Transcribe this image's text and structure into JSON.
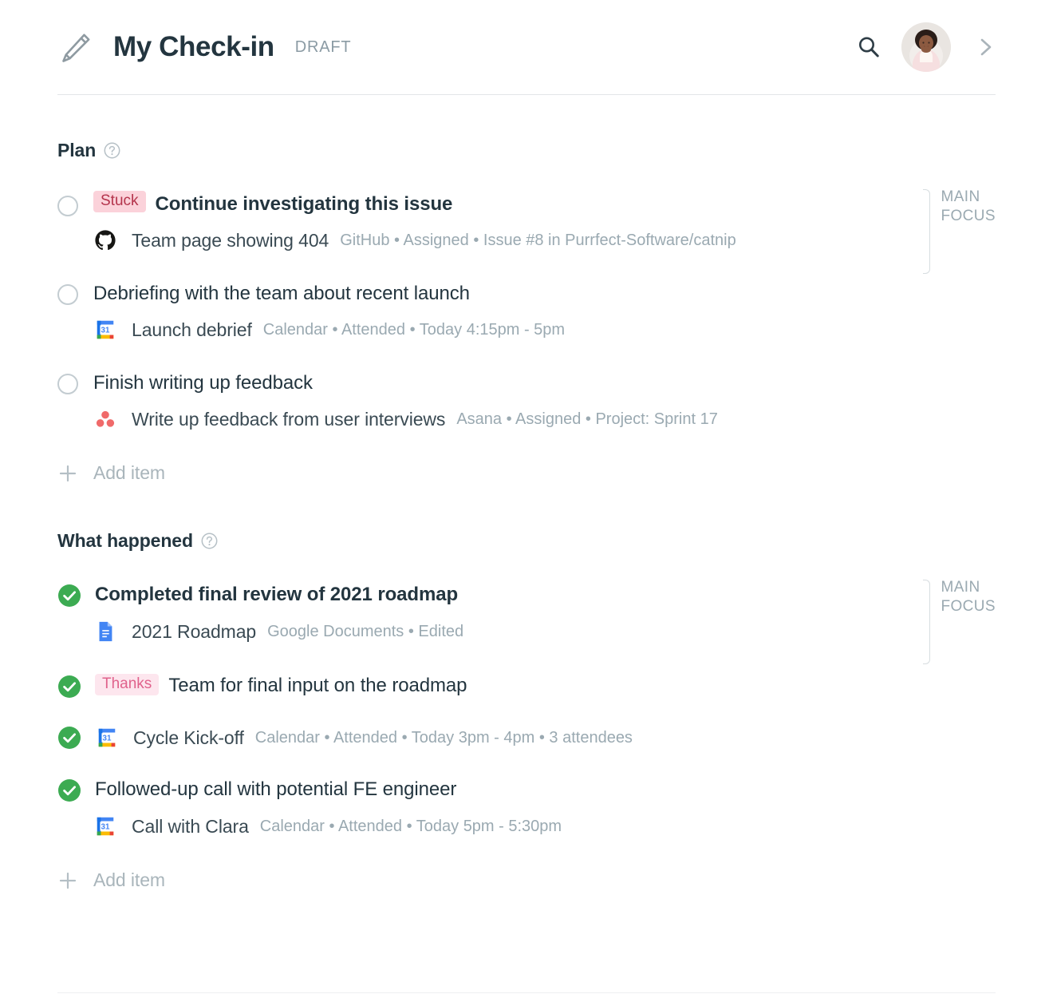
{
  "header": {
    "pencil_icon": "pencil-icon",
    "title": "My Check-in",
    "status": "DRAFT",
    "search_icon": "search-icon",
    "avatar_alt": "user-avatar",
    "chevron_icon": "chevron-right-icon"
  },
  "focus_label": "MAIN\nFOCUS",
  "add_item_label": "Add item",
  "sections": [
    {
      "title": "Plan",
      "help_icon": "help-circle-icon",
      "items": [
        {
          "state": "unchecked",
          "badge": "Stuck",
          "badge_kind": "stuck",
          "title": "Continue investigating this issue",
          "bold": true,
          "main_focus": true,
          "sub": {
            "icon": "github-icon",
            "title": "Team page showing 404",
            "meta": "GitHub • Assigned • Issue #8 in Purrfect-Software/catnip"
          }
        },
        {
          "state": "unchecked",
          "badge": "",
          "title": "Debriefing with the team about recent launch",
          "bold": false,
          "main_focus": false,
          "sub": {
            "icon": "google-calendar-icon",
            "title": "Launch debrief",
            "meta": "Calendar • Attended • Today 4:15pm - 5pm"
          }
        },
        {
          "state": "unchecked",
          "badge": "",
          "title": "Finish writing up feedback",
          "bold": false,
          "main_focus": false,
          "sub": {
            "icon": "asana-icon",
            "title": "Write up feedback from user interviews",
            "meta": "Asana • Assigned • Project: Sprint 17"
          }
        }
      ]
    },
    {
      "title": "What happened",
      "help_icon": "help-circle-icon",
      "items": [
        {
          "state": "checked",
          "badge": "",
          "title": "Completed final review of 2021 roadmap",
          "bold": true,
          "main_focus": true,
          "sub": {
            "icon": "google-docs-icon",
            "title": "2021 Roadmap",
            "meta": "Google Documents • Edited"
          }
        },
        {
          "state": "checked",
          "badge": "Thanks",
          "badge_kind": "thanks",
          "title": "Team for final input on the roadmap",
          "bold": false,
          "main_focus": false,
          "sub": null
        },
        {
          "state": "checked",
          "badge": "",
          "title": "",
          "bold": false,
          "main_focus": false,
          "inline_sub": true,
          "sub": {
            "icon": "google-calendar-icon",
            "title": "Cycle Kick-off",
            "meta": "Calendar • Attended • Today 3pm - 4pm • 3 attendees"
          }
        },
        {
          "state": "checked",
          "badge": "",
          "title": "Followed-up call with potential FE engineer",
          "bold": false,
          "main_focus": false,
          "sub": {
            "icon": "google-calendar-icon",
            "title": "Call with Clara",
            "meta": "Calendar • Attended • Today 5pm - 5:30pm"
          }
        }
      ]
    }
  ],
  "colors": {
    "title": "#23353f",
    "muted": "#9aa9b1",
    "badge_stuck_bg": "#fbd2da",
    "badge_stuck_fg": "#b4344c",
    "badge_thanks_bg": "#fde6ee",
    "badge_thanks_fg": "#e0628c",
    "check_green": "#3cab52",
    "asana_coral": "#f06a6a",
    "docs_blue": "#4285f4"
  }
}
